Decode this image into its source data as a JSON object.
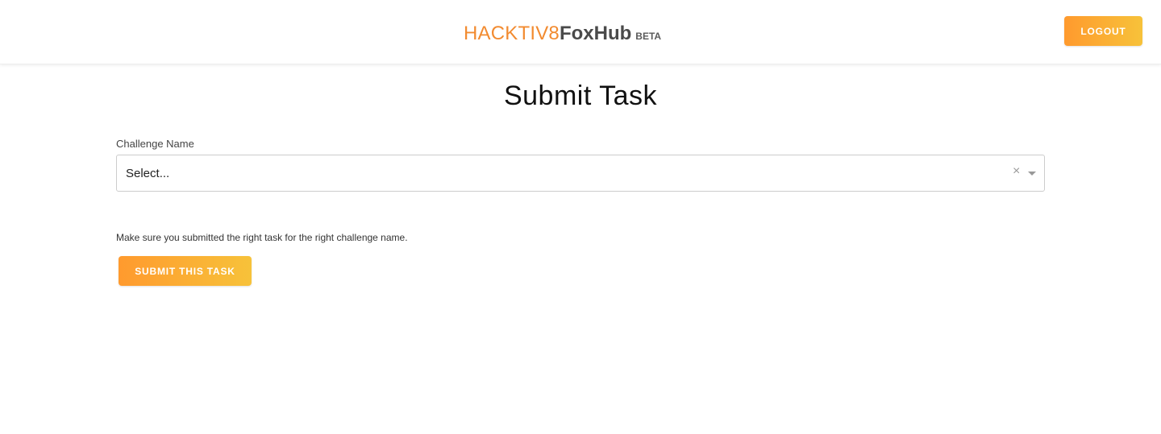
{
  "header": {
    "brand_primary": "HACKTIV8",
    "brand_secondary": "FoxHub",
    "brand_badge": "BETA",
    "logout_label": "LOGOUT"
  },
  "main": {
    "title": "Submit Task",
    "challenge_field": {
      "label": "Challenge Name",
      "value": "Select...",
      "clear_glyph": "×"
    },
    "note": "Make sure you submitted the right task for the right challenge name.",
    "submit_label": "SUBMIT THIS TASK"
  },
  "colors": {
    "brand_orange": "#f28b30",
    "brand_dark": "#4a4a4a",
    "button_gradient_start": "#ff9a2e",
    "button_gradient_end": "#f7c23a"
  },
  "icons": {
    "clear": "close-icon",
    "dropdown": "chevron-down-icon"
  }
}
